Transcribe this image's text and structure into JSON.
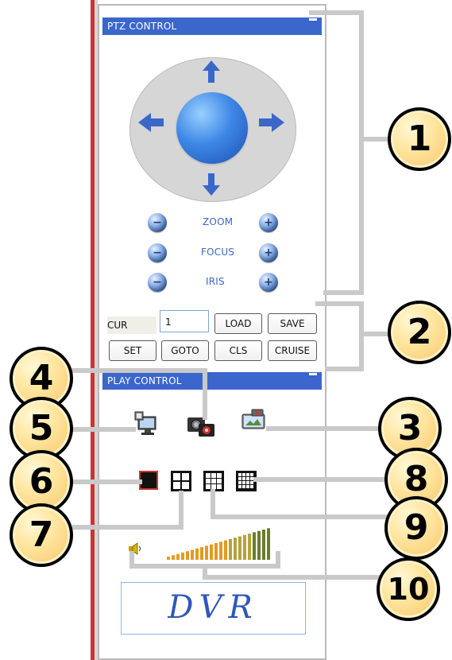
{
  "ptz_control": {
    "title": "PTZ CONTROL",
    "labels": {
      "zoom": "ZOOM",
      "focus": "FOCUS",
      "iris": "IRIS"
    },
    "minus_symbol": "−",
    "plus_symbol": "+",
    "preset": {
      "cur_label": "CUR",
      "cur_value": "1",
      "buttons": {
        "load": "LOAD",
        "save": "SAVE",
        "set": "SET",
        "goto": "GOTO",
        "cls": "CLS",
        "cruise": "CRUISE"
      }
    }
  },
  "play_control": {
    "title": "PLAY CONTROL",
    "icons": {
      "network": "network-icon",
      "camera": "camera-icon",
      "photo": "photo-icon",
      "speaker": "speaker-icon"
    },
    "volume_level": 1.0
  },
  "logo": {
    "text": "DVR"
  },
  "callouts": {
    "c1": "1",
    "c2": "2",
    "c3": "3",
    "c4": "4",
    "c5": "5",
    "c6": "6",
    "c7": "7",
    "c8": "8",
    "c9": "9",
    "c10": "10"
  },
  "colors": {
    "title_bar": "#3b66cc",
    "ptz_blue": "#3a67c8",
    "volume_orange": "#cc8c2a",
    "left_edge_red": "#cc3333"
  }
}
